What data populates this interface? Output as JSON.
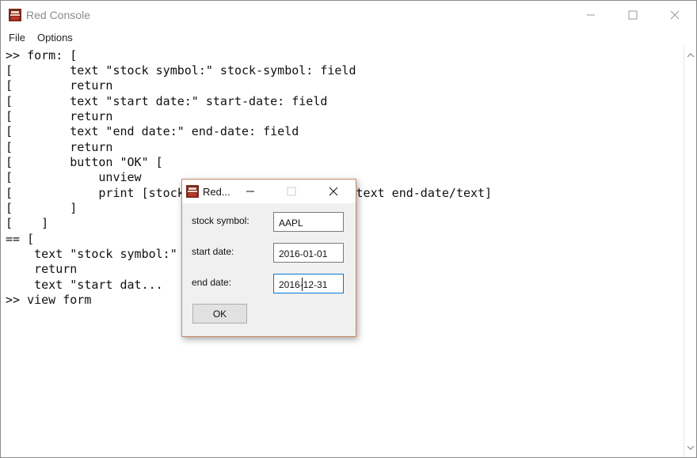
{
  "window": {
    "title": "Red Console",
    "icon": "red-logo-icon",
    "controls": [
      "minimize-icon",
      "maximize-icon",
      "close-icon"
    ]
  },
  "menubar": {
    "items": [
      {
        "label": "File"
      },
      {
        "label": "Options"
      }
    ]
  },
  "console": {
    "lines": [
      ">> form: [",
      "[        text \"stock symbol:\" stock-symbol: field",
      "[        return",
      "[        text \"start date:\" start-date: field",
      "[        return",
      "[        text \"end date:\" end-date: field",
      "[        return",
      "[        button \"OK\" [",
      "[            unview",
      "[            print [stock-symbol/text start-date/text end-date/text]",
      "[        ]",
      "[    ]",
      "== [",
      "    text \"stock symbol:\" stock-symbol: field",
      "    return",
      "    text \"start dat...",
      ">> view form"
    ]
  },
  "dialog": {
    "title": "Red...",
    "icon": "red-logo-icon",
    "fields": [
      {
        "label": "stock symbol:",
        "value": "AAPL"
      },
      {
        "label": "start date:",
        "value": "2016-01-01"
      },
      {
        "label": "end date:",
        "value": "2016-12-31"
      }
    ],
    "ok_label": "OK"
  },
  "colors": {
    "dialog_border": "#c98866",
    "focus_border": "#0078d7",
    "logo": "#c0392b"
  }
}
